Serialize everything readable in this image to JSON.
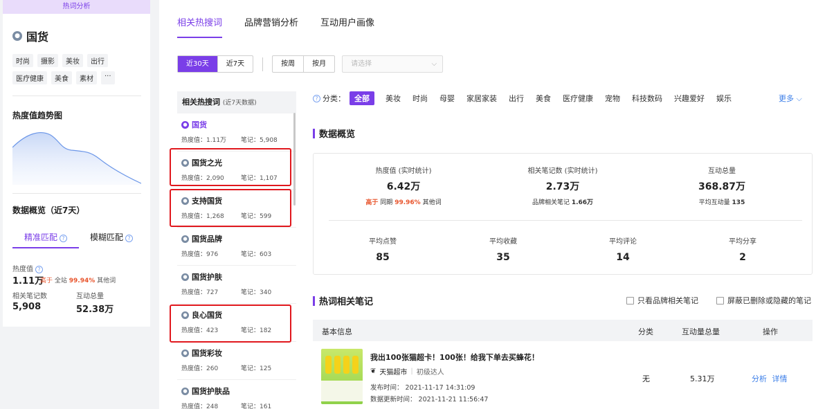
{
  "left": {
    "top_label": "热词分析",
    "keyword": "国货",
    "tags": [
      "时尚",
      "摄影",
      "美妆",
      "出行",
      "医疗健康",
      "美食",
      "素材",
      "···"
    ],
    "trend_title": "热度值趋势图",
    "overview_title": "数据概览（近7天）",
    "match_tabs": [
      "精准匹配",
      "模糊匹配"
    ],
    "heat_label": "热度值",
    "heat_value": "1.11万",
    "heat_compare_prefix": "高于",
    "heat_compare_mid": "全站",
    "heat_compare_pct": "99.94%",
    "heat_compare_suffix": "其他词",
    "notes_label": "相关笔记数",
    "notes_value": "5,908",
    "interact_label": "互动总量",
    "interact_value": "52.38万"
  },
  "tabs": [
    "相关热搜词",
    "品牌营销分析",
    "互动用户画像"
  ],
  "filters": {
    "range": [
      "近30天",
      "近7天"
    ],
    "period": [
      "按周",
      "按月"
    ],
    "select_placeholder": "请选择"
  },
  "related": {
    "title": "相关热搜词",
    "subtitle": "(近7天数据)",
    "heat_prefix": "热度值：",
    "notes_prefix": "笔记：",
    "items": [
      {
        "name": "国货",
        "heat": "1.11万",
        "notes": "5,908"
      },
      {
        "name": "国货之光",
        "heat": "2,090",
        "notes": "1,107"
      },
      {
        "name": "支持国货",
        "heat": "1,268",
        "notes": "599"
      },
      {
        "name": "国货品牌",
        "heat": "976",
        "notes": "603"
      },
      {
        "name": "国货护肤",
        "heat": "727",
        "notes": "340"
      },
      {
        "name": "良心国货",
        "heat": "423",
        "notes": "182"
      },
      {
        "name": "国货彩妆",
        "heat": "260",
        "notes": "125"
      },
      {
        "name": "国货护肤品",
        "heat": "248",
        "notes": "161"
      }
    ]
  },
  "categories": {
    "label": "分类：",
    "items": [
      "全部",
      "美妆",
      "时尚",
      "母婴",
      "家居家装",
      "出行",
      "美食",
      "医疗健康",
      "宠物",
      "科技数码",
      "兴趣爱好",
      "娱乐"
    ],
    "more": "更多"
  },
  "overview": {
    "title": "数据概览",
    "heat_label": "热度值 (实时统计)",
    "heat_value": "6.42万",
    "heat_sub_prefix": "高于",
    "heat_sub_mid": "同期",
    "heat_sub_pct": "99.96%",
    "heat_sub_suffix": "其他词",
    "notes_label": "相关笔记数 (实时统计)",
    "notes_value": "2.73万",
    "notes_sub_label": "品牌相关笔记",
    "notes_sub_value": "1.66万",
    "interact_label": "互动总量",
    "interact_value": "368.87万",
    "interact_sub_label": "平均互动量",
    "interact_sub_value": "135",
    "avg_like_label": "平均点赞",
    "avg_like_value": "85",
    "avg_fav_label": "平均收藏",
    "avg_fav_value": "35",
    "avg_comment_label": "平均评论",
    "avg_comment_value": "14",
    "avg_share_label": "平均分享",
    "avg_share_value": "2"
  },
  "notes": {
    "title": "热词相关笔记",
    "only_brand": "只看品牌相关笔记",
    "hide_deleted": "屏蔽已删除或隐藏的笔记",
    "columns": [
      "基本信息",
      "分类",
      "互动量总量",
      "操作"
    ],
    "rows": [
      {
        "title": "我出100张猫超卡！100张！给我下单去买蜂花！",
        "author": "天猫超市",
        "level": "初级达人",
        "publish": "发布时间：  2021-11-17 14:31:09",
        "updated": "数据更新时间：  2021-11-21 11:56:47",
        "category": "无",
        "interactions": "5.31万",
        "action_analyze": "分析",
        "action_detail": "详情"
      }
    ]
  },
  "colors": {
    "accent": "#7a3ee8",
    "highlight_box": "#e0171d",
    "link": "#3b7ee8",
    "up": "#e8542c"
  }
}
